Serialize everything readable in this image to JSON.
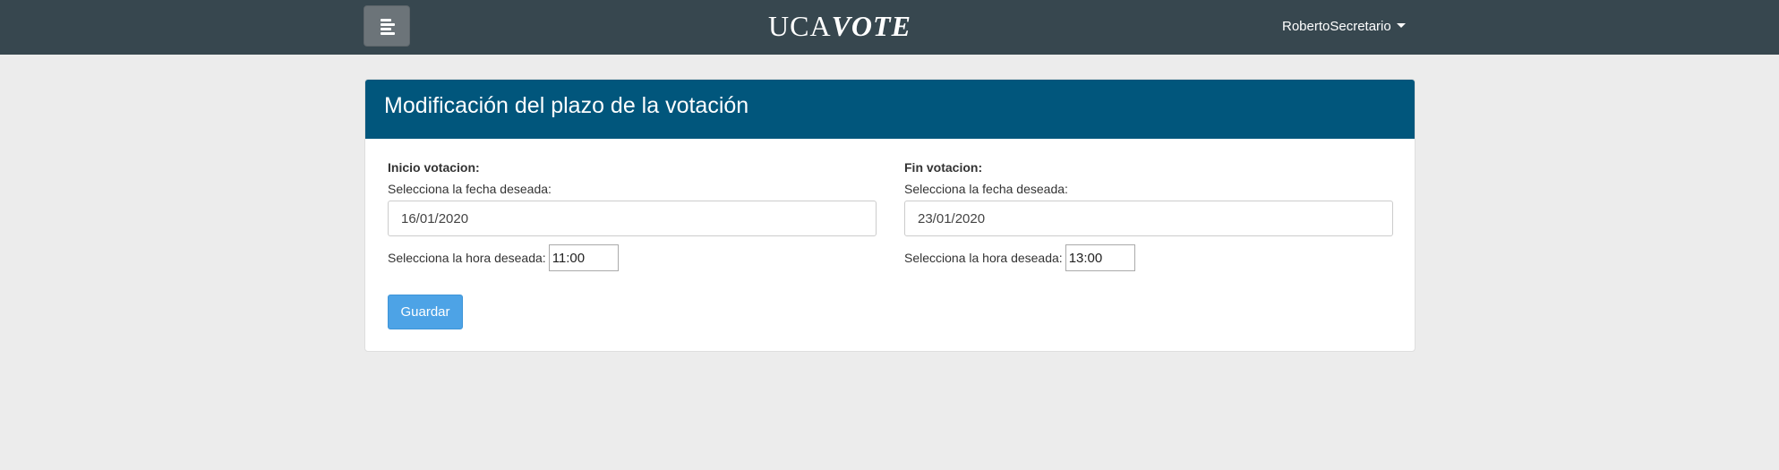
{
  "navbar": {
    "brand_part1": "UCA",
    "brand_part2": "VOTE",
    "user_name": "RobertoSecretario"
  },
  "card": {
    "title": "Modificación del plazo de la votación",
    "start": {
      "section_label": "Inicio votacion:",
      "date_label": "Selecciona la fecha deseada:",
      "date_value": "16/01/2020",
      "time_label": "Selecciona la hora deseada:",
      "time_value": "11:00"
    },
    "end": {
      "section_label": "Fin votacion:",
      "date_label": "Selecciona la fecha deseada:",
      "date_value": "23/01/2020",
      "time_label": "Selecciona la hora deseada:",
      "time_value": "13:00"
    },
    "save_label": "Guardar"
  },
  "colors": {
    "navbar_bg": "#37474f",
    "card_header_bg": "#01567c",
    "primary_button": "#4da3e6",
    "page_bg": "#ececec"
  },
  "icons": {
    "menu": "menu-icon",
    "user_dropdown": "caret-down-icon"
  }
}
